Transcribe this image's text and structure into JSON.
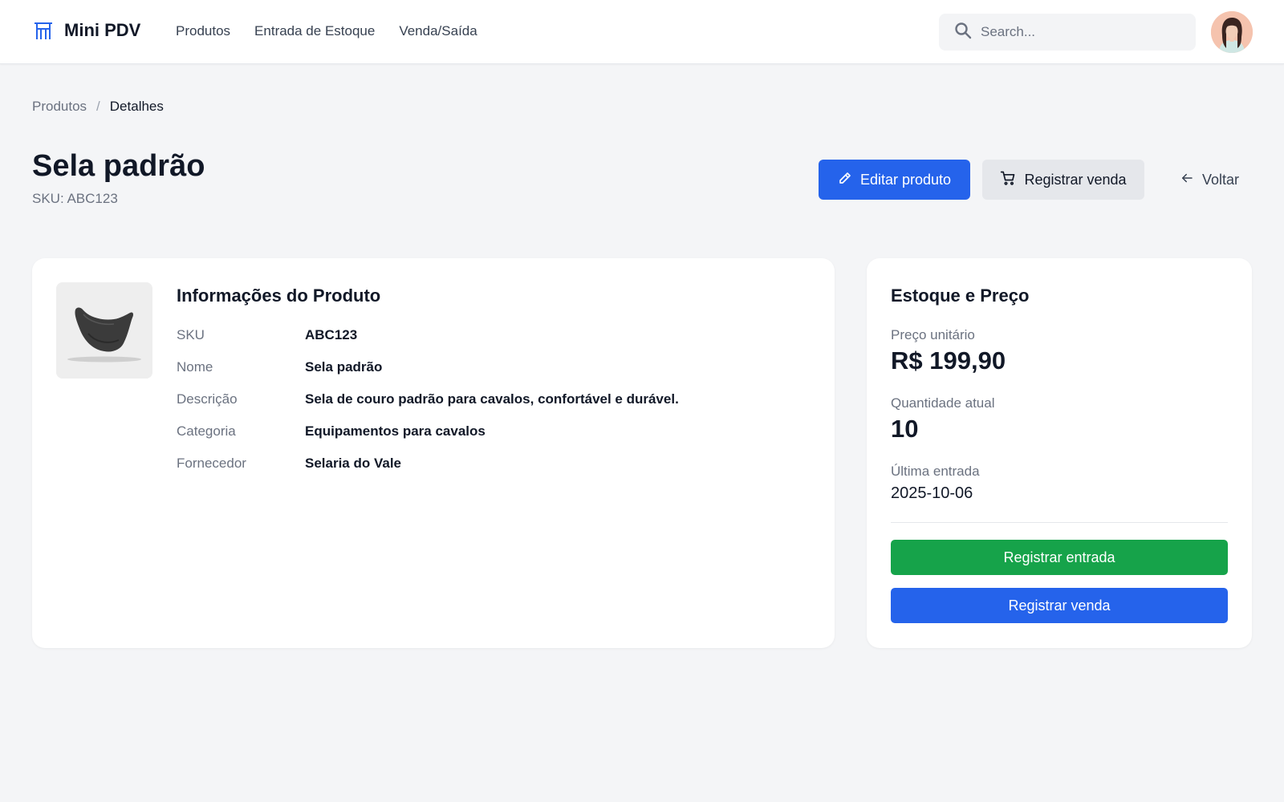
{
  "app": {
    "name": "Mini PDV"
  },
  "nav": {
    "items": [
      "Produtos",
      "Entrada de Estoque",
      "Venda/Saída"
    ]
  },
  "search": {
    "placeholder": "Search..."
  },
  "breadcrumb": {
    "parent": "Produtos",
    "separator": "/",
    "current": "Detalhes"
  },
  "product": {
    "title": "Sela padrão",
    "sku_line": "SKU: ABC123"
  },
  "actions": {
    "edit": "Editar produto",
    "register_sale": "Registrar venda",
    "back": "Voltar"
  },
  "info": {
    "title": "Informações do Produto",
    "rows": [
      {
        "label": "SKU",
        "value": "ABC123"
      },
      {
        "label": "Nome",
        "value": "Sela padrão"
      },
      {
        "label": "Descrição",
        "value": "Sela de couro padrão para cavalos, confortável e durável."
      },
      {
        "label": "Categoria",
        "value": "Equipamentos para cavalos"
      },
      {
        "label": "Fornecedor",
        "value": "Selaria do Vale"
      }
    ]
  },
  "stock": {
    "title": "Estoque e Preço",
    "price_label": "Preço unitário",
    "price": "R$ 199,90",
    "qty_label": "Quantidade atual",
    "qty": "10",
    "last_entry_label": "Última entrada",
    "last_entry": "2025-10-06",
    "btn_entrada": "Registrar entrada",
    "btn_venda": "Registrar venda"
  },
  "colors": {
    "primary": "#2563eb",
    "success": "#16a34a",
    "background": "#f4f5f7"
  },
  "icons": [
    "brand-icon",
    "search-icon",
    "avatar",
    "pencil-icon",
    "cart-icon",
    "arrow-left-icon",
    "saddle-image"
  ]
}
